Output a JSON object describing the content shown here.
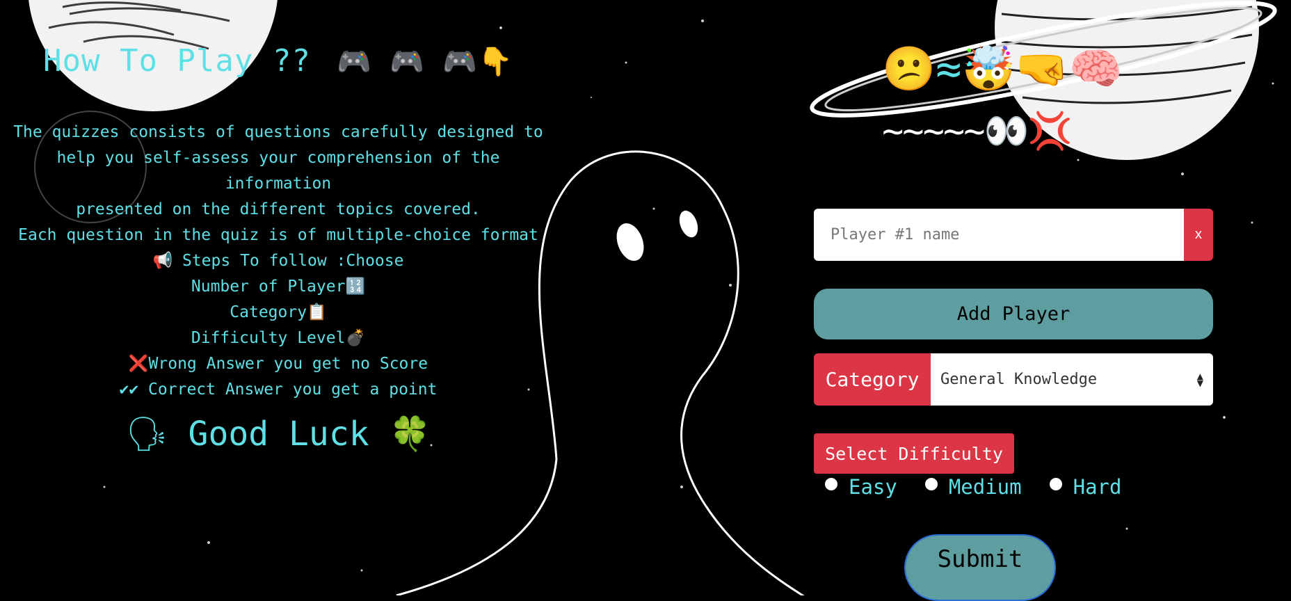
{
  "howto": {
    "title": "How To Play ??",
    "title_emojis": "🎮 🎮 🎮👇",
    "intro_lines": [
      "The quizzes consists of questions carefully designed to",
      "help you self-assess your comprehension of the information",
      "presented on the different topics covered.",
      "Each question in the quiz is of multiple-choice format"
    ],
    "steps": [
      "📢  Steps To follow :Choose",
      "Number of Player🔢",
      "Category📋",
      "Difficulty Level💣",
      "❌Wrong Answer you get no Score",
      "✔✔ Correct Answer you get a point"
    ],
    "good_luck": "🗣 Good Luck 🍀"
  },
  "header_emojis": {
    "line1": "😕≈🤯🤜🧠",
    "line2": "~~~~~👀💢"
  },
  "form": {
    "player_placeholder": "Player #1 name",
    "remove_label": "x",
    "add_player_label": "Add Player",
    "category_label": "Category",
    "category_value": "General Knowledge",
    "difficulty_label": "Select Difficulty",
    "difficulty_options": [
      "Easy",
      "Medium",
      "Hard"
    ],
    "submit_label": "Submit"
  },
  "colors": {
    "accent_text": "#5ee0e6",
    "danger": "#dc3545",
    "teal_button": "#5f9ea0",
    "background": "#000000"
  }
}
